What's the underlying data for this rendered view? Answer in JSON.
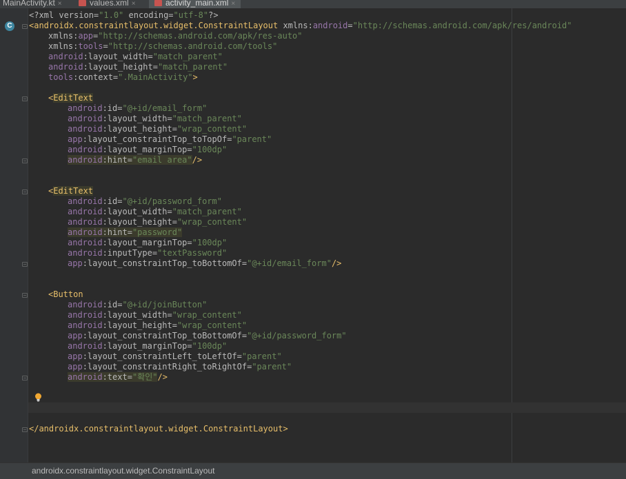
{
  "tabs": [
    {
      "label": "MainActivity.kt",
      "active": false,
      "closable": true
    },
    {
      "label": "values.xml",
      "active": false,
      "closable": true
    },
    {
      "label": "activity_main.xml",
      "active": true,
      "closable": true
    }
  ],
  "tab_close_glyph": "×",
  "gutter_class_icon_letter": "C",
  "code": {
    "l1": {
      "pi_open": "<?xml ",
      "version_attr": "version=",
      "version_val": "\"1.0\"",
      "encoding_attr": " encoding=",
      "encoding_val": "\"utf-8\"",
      "pi_close": "?>"
    },
    "l2": {
      "open": "<androidx.constraintlayout.widget.ConstraintLayout",
      "xmlns_attr": " xmlns:",
      "ns": "android",
      "eq": "=",
      "val": "\"http://schemas.android.com/apk/res/android\""
    },
    "l3": {
      "attr": "xmlns:",
      "ns": "app",
      "eq": "=",
      "val": "\"http://schemas.android.com/apk/res-auto\""
    },
    "l4": {
      "attr": "xmlns:",
      "ns": "tools",
      "eq": "=",
      "val": "\"http://schemas.android.com/tools\""
    },
    "l5": {
      "ns": "android",
      "attr": ":layout_width=",
      "val": "\"match_parent\""
    },
    "l6": {
      "ns": "android",
      "attr": ":layout_height=",
      "val": "\"match_parent\""
    },
    "l7": {
      "ns": "tools",
      "attr": ":context=",
      "val": "\".MainActivity\"",
      "close": ">"
    },
    "e1_open": {
      "lt": "<",
      "name": "EditText"
    },
    "e1": [
      {
        "ns": "android",
        "attr": ":id=",
        "val": "\"@+id/email_form\""
      },
      {
        "ns": "android",
        "attr": ":layout_width=",
        "val": "\"match_parent\""
      },
      {
        "ns": "android",
        "attr": ":layout_height=",
        "val": "\"wrap_content\""
      },
      {
        "ns": "app",
        "attr": ":layout_constraintTop_toTopOf=",
        "val": "\"parent\""
      },
      {
        "ns": "android",
        "attr": ":layout_marginTop=",
        "val": "\"100dp\""
      },
      {
        "ns": "android",
        "attr": ":hint=",
        "val": "\"email area\"",
        "close": "/>"
      }
    ],
    "e2_open": {
      "lt": "<",
      "name": "EditText"
    },
    "e2": [
      {
        "ns": "android",
        "attr": ":id=",
        "val": "\"@+id/password_form\""
      },
      {
        "ns": "android",
        "attr": ":layout_width=",
        "val": "\"match_parent\""
      },
      {
        "ns": "android",
        "attr": ":layout_height=",
        "val": "\"wrap_content\""
      },
      {
        "ns": "android",
        "attr": ":hint=",
        "val": "\"password\""
      },
      {
        "ns": "android",
        "attr": ":layout_marginTop=",
        "val": "\"100dp\""
      },
      {
        "ns": "android",
        "attr": ":inputType=",
        "val": "\"textPassword\""
      },
      {
        "ns": "app",
        "attr": ":layout_constraintTop_toBottomOf=",
        "val": "\"@+id/email_form\"",
        "close": "/>"
      }
    ],
    "b_open": {
      "lt": "<",
      "name": "Button"
    },
    "b": [
      {
        "ns": "android",
        "attr": ":id=",
        "val": "\"@+id/joinButton\""
      },
      {
        "ns": "android",
        "attr": ":layout_width=",
        "val": "\"wrap_content\""
      },
      {
        "ns": "android",
        "attr": ":layout_height=",
        "val": "\"wrap_content\""
      },
      {
        "ns": "app",
        "attr": ":layout_constraintTop_toBottomOf=",
        "val": "\"@+id/password_form\""
      },
      {
        "ns": "android",
        "attr": ":layout_marginTop=",
        "val": "\"100dp\""
      },
      {
        "ns": "app",
        "attr": ":layout_constraintLeft_toLeftOf=",
        "val": "\"parent\""
      },
      {
        "ns": "app",
        "attr": ":layout_constraintRight_toRightOf=",
        "val": "\"parent\""
      },
      {
        "ns": "android",
        "attr": ":text=",
        "val": "\"확인\"",
        "close": "/>"
      }
    ],
    "closing": "</androidx.constraintlayout.widget.ConstraintLayout>"
  },
  "status_bar": {
    "breadcrumb": "androidx.constraintlayout.widget.ConstraintLayout"
  },
  "colors": {
    "tag": "#e8bf6a",
    "namespace": "#9876aa",
    "attribute": "#bababa",
    "value": "#6a8759",
    "background": "#2b2b2b",
    "warning_highlight": "#3b3b2c"
  }
}
